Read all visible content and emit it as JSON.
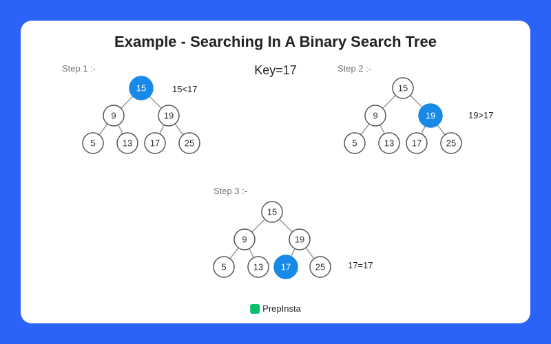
{
  "title": "Example - Searching In A Binary Search Tree",
  "key": "Key=17",
  "tree": {
    "nodes": [
      "15",
      "9",
      "19",
      "5",
      "13",
      "17",
      "25"
    ]
  },
  "steps": [
    {
      "label": "Step 1 :-",
      "comparison": "15<17",
      "highlight": "15"
    },
    {
      "label": "Step 2 :-",
      "comparison": "19>17",
      "highlight": "19"
    },
    {
      "label": "Step 3 :-",
      "comparison": "17=17",
      "highlight": "17"
    }
  ],
  "brand": "PrepInsta"
}
